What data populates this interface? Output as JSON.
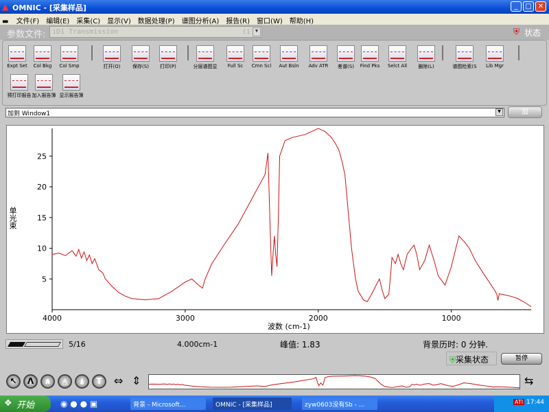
{
  "window": {
    "title": "OMNIC - [采集样品]",
    "min": "_",
    "max": "□",
    "close": "✕"
  },
  "menu": [
    "文件(F)",
    "编辑(E)",
    "采集(C)",
    "显示(V)",
    "数据处理(P)",
    "谱图分析(A)",
    "报告(R)",
    "窗口(W)",
    "帮助(H)"
  ],
  "param": {
    "label": "参数文件:",
    "value": "iD1 Transmission",
    "dropdown": "(i",
    "status_label": "状态"
  },
  "toolbar": {
    "row1": [
      "Expt Set",
      "Col Bkg",
      "Col Smp",
      "打开(O)",
      "保存(S)",
      "打印(P)",
      "分层谱图显",
      "Full Sc",
      "Cmn Scl",
      "Aut Bsln",
      "Adv ATR",
      "差谱(S)",
      "Find Pks",
      "Selct All",
      "删除(L)",
      "谱图检索(S",
      "Lib Mgr"
    ],
    "row2": [
      "预打印报告",
      "加入报告簿",
      "显示报告簿"
    ]
  },
  "window_select": {
    "value": "加到 Window1",
    "add_button": "加"
  },
  "chart_data": {
    "type": "line",
    "xlabel": "波数 (cm-1)",
    "ylabel": "单光束",
    "xlim": [
      4000,
      400
    ],
    "ylim": [
      0,
      29.5
    ],
    "xticks": [
      4000,
      3000,
      2000,
      1000
    ],
    "yticks": [
      5,
      10,
      15,
      20,
      25
    ],
    "color": "#cc1111",
    "points": [
      [
        4000,
        9
      ],
      [
        3950,
        9.2
      ],
      [
        3900,
        8.8
      ],
      [
        3850,
        9.6
      ],
      [
        3820,
        8.7
      ],
      [
        3800,
        9.8
      ],
      [
        3780,
        8.4
      ],
      [
        3760,
        9.4
      ],
      [
        3740,
        8
      ],
      [
        3720,
        8.9
      ],
      [
        3700,
        7.5
      ],
      [
        3680,
        8.3
      ],
      [
        3650,
        6.5
      ],
      [
        3620,
        6
      ],
      [
        3600,
        5
      ],
      [
        3550,
        3.8
      ],
      [
        3500,
        2.8
      ],
      [
        3450,
        2.2
      ],
      [
        3400,
        1.8
      ],
      [
        3300,
        1.6
      ],
      [
        3200,
        1.8
      ],
      [
        3100,
        3
      ],
      [
        3000,
        4.5
      ],
      [
        2950,
        5
      ],
      [
        2900,
        4
      ],
      [
        2870,
        3.5
      ],
      [
        2850,
        5
      ],
      [
        2800,
        7.5
      ],
      [
        2700,
        10.8
      ],
      [
        2600,
        14
      ],
      [
        2500,
        18
      ],
      [
        2400,
        22
      ],
      [
        2378,
        25.5
      ],
      [
        2360,
        12
      ],
      [
        2350,
        5.5
      ],
      [
        2340,
        9
      ],
      [
        2330,
        12
      ],
      [
        2320,
        9
      ],
      [
        2310,
        7
      ],
      [
        2300,
        15
      ],
      [
        2290,
        25
      ],
      [
        2250,
        27.5
      ],
      [
        2200,
        28
      ],
      [
        2100,
        28.5
      ],
      [
        2000,
        29.5
      ],
      [
        1950,
        29
      ],
      [
        1900,
        28
      ],
      [
        1870,
        27
      ],
      [
        1845,
        26
      ],
      [
        1820,
        24
      ],
      [
        1800,
        22
      ],
      [
        1775,
        16
      ],
      [
        1750,
        10
      ],
      [
        1720,
        5
      ],
      [
        1700,
        3
      ],
      [
        1660,
        1.6
      ],
      [
        1632,
        1.3
      ],
      [
        1600,
        2.5
      ],
      [
        1560,
        4.2
      ],
      [
        1540,
        5
      ],
      [
        1520,
        3.2
      ],
      [
        1500,
        1.8
      ],
      [
        1470,
        2.5
      ],
      [
        1455,
        6
      ],
      [
        1446,
        8.5
      ],
      [
        1420,
        7.5
      ],
      [
        1400,
        9
      ],
      [
        1380,
        7.5
      ],
      [
        1360,
        6.5
      ],
      [
        1332,
        9
      ],
      [
        1300,
        10
      ],
      [
        1280,
        10.5
      ],
      [
        1260,
        9
      ],
      [
        1238,
        6.5
      ],
      [
        1200,
        8
      ],
      [
        1166,
        10.5
      ],
      [
        1130,
        8
      ],
      [
        1098,
        5.5
      ],
      [
        1047,
        4
      ],
      [
        1000,
        7
      ],
      [
        943,
        12
      ],
      [
        900,
        11
      ],
      [
        865,
        10
      ],
      [
        820,
        8
      ],
      [
        762,
        6
      ],
      [
        700,
        4
      ],
      [
        670,
        3
      ],
      [
        658,
        2.5
      ],
      [
        650,
        1.5
      ],
      [
        640,
        2.6
      ],
      [
        600,
        2.4
      ],
      [
        554,
        2.2
      ],
      [
        500,
        1.8
      ],
      [
        450,
        1.2
      ],
      [
        400,
        0.5
      ]
    ]
  },
  "status": {
    "scan": "5/16",
    "resolution": "4.000cm-1",
    "peak": "峰值: 1.83",
    "background": "背景历时: 0 分钟.",
    "collect_status": "采集状态",
    "pause": "暂停"
  },
  "taskbar": {
    "start": "开始",
    "tasks": [
      "背景 - Microsoft...",
      "OMNIC - [采集样品]",
      "zyw0603没有Sb - ..."
    ],
    "clock": "17:44",
    "tray_badge": "ATI"
  }
}
